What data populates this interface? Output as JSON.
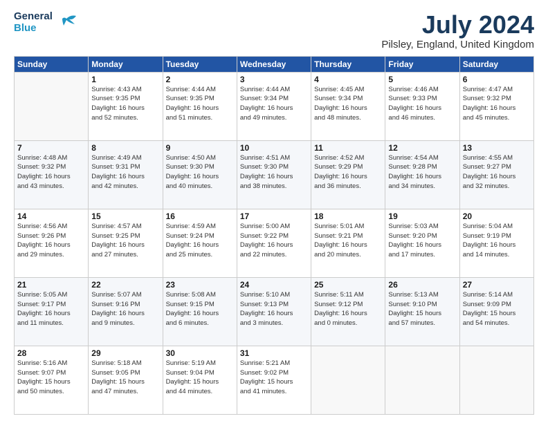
{
  "logo": {
    "general": "General",
    "blue": "Blue",
    "tagline": ""
  },
  "header": {
    "month": "July 2024",
    "location": "Pilsley, England, United Kingdom"
  },
  "weekdays": [
    "Sunday",
    "Monday",
    "Tuesday",
    "Wednesday",
    "Thursday",
    "Friday",
    "Saturday"
  ],
  "weeks": [
    [
      {
        "day": "",
        "info": ""
      },
      {
        "day": "1",
        "info": "Sunrise: 4:43 AM\nSunset: 9:35 PM\nDaylight: 16 hours\nand 52 minutes."
      },
      {
        "day": "2",
        "info": "Sunrise: 4:44 AM\nSunset: 9:35 PM\nDaylight: 16 hours\nand 51 minutes."
      },
      {
        "day": "3",
        "info": "Sunrise: 4:44 AM\nSunset: 9:34 PM\nDaylight: 16 hours\nand 49 minutes."
      },
      {
        "day": "4",
        "info": "Sunrise: 4:45 AM\nSunset: 9:34 PM\nDaylight: 16 hours\nand 48 minutes."
      },
      {
        "day": "5",
        "info": "Sunrise: 4:46 AM\nSunset: 9:33 PM\nDaylight: 16 hours\nand 46 minutes."
      },
      {
        "day": "6",
        "info": "Sunrise: 4:47 AM\nSunset: 9:32 PM\nDaylight: 16 hours\nand 45 minutes."
      }
    ],
    [
      {
        "day": "7",
        "info": "Sunrise: 4:48 AM\nSunset: 9:32 PM\nDaylight: 16 hours\nand 43 minutes."
      },
      {
        "day": "8",
        "info": "Sunrise: 4:49 AM\nSunset: 9:31 PM\nDaylight: 16 hours\nand 42 minutes."
      },
      {
        "day": "9",
        "info": "Sunrise: 4:50 AM\nSunset: 9:30 PM\nDaylight: 16 hours\nand 40 minutes."
      },
      {
        "day": "10",
        "info": "Sunrise: 4:51 AM\nSunset: 9:30 PM\nDaylight: 16 hours\nand 38 minutes."
      },
      {
        "day": "11",
        "info": "Sunrise: 4:52 AM\nSunset: 9:29 PM\nDaylight: 16 hours\nand 36 minutes."
      },
      {
        "day": "12",
        "info": "Sunrise: 4:54 AM\nSunset: 9:28 PM\nDaylight: 16 hours\nand 34 minutes."
      },
      {
        "day": "13",
        "info": "Sunrise: 4:55 AM\nSunset: 9:27 PM\nDaylight: 16 hours\nand 32 minutes."
      }
    ],
    [
      {
        "day": "14",
        "info": "Sunrise: 4:56 AM\nSunset: 9:26 PM\nDaylight: 16 hours\nand 29 minutes."
      },
      {
        "day": "15",
        "info": "Sunrise: 4:57 AM\nSunset: 9:25 PM\nDaylight: 16 hours\nand 27 minutes."
      },
      {
        "day": "16",
        "info": "Sunrise: 4:59 AM\nSunset: 9:24 PM\nDaylight: 16 hours\nand 25 minutes."
      },
      {
        "day": "17",
        "info": "Sunrise: 5:00 AM\nSunset: 9:22 PM\nDaylight: 16 hours\nand 22 minutes."
      },
      {
        "day": "18",
        "info": "Sunrise: 5:01 AM\nSunset: 9:21 PM\nDaylight: 16 hours\nand 20 minutes."
      },
      {
        "day": "19",
        "info": "Sunrise: 5:03 AM\nSunset: 9:20 PM\nDaylight: 16 hours\nand 17 minutes."
      },
      {
        "day": "20",
        "info": "Sunrise: 5:04 AM\nSunset: 9:19 PM\nDaylight: 16 hours\nand 14 minutes."
      }
    ],
    [
      {
        "day": "21",
        "info": "Sunrise: 5:05 AM\nSunset: 9:17 PM\nDaylight: 16 hours\nand 11 minutes."
      },
      {
        "day": "22",
        "info": "Sunrise: 5:07 AM\nSunset: 9:16 PM\nDaylight: 16 hours\nand 9 minutes."
      },
      {
        "day": "23",
        "info": "Sunrise: 5:08 AM\nSunset: 9:15 PM\nDaylight: 16 hours\nand 6 minutes."
      },
      {
        "day": "24",
        "info": "Sunrise: 5:10 AM\nSunset: 9:13 PM\nDaylight: 16 hours\nand 3 minutes."
      },
      {
        "day": "25",
        "info": "Sunrise: 5:11 AM\nSunset: 9:12 PM\nDaylight: 16 hours\nand 0 minutes."
      },
      {
        "day": "26",
        "info": "Sunrise: 5:13 AM\nSunset: 9:10 PM\nDaylight: 15 hours\nand 57 minutes."
      },
      {
        "day": "27",
        "info": "Sunrise: 5:14 AM\nSunset: 9:09 PM\nDaylight: 15 hours\nand 54 minutes."
      }
    ],
    [
      {
        "day": "28",
        "info": "Sunrise: 5:16 AM\nSunset: 9:07 PM\nDaylight: 15 hours\nand 50 minutes."
      },
      {
        "day": "29",
        "info": "Sunrise: 5:18 AM\nSunset: 9:05 PM\nDaylight: 15 hours\nand 47 minutes."
      },
      {
        "day": "30",
        "info": "Sunrise: 5:19 AM\nSunset: 9:04 PM\nDaylight: 15 hours\nand 44 minutes."
      },
      {
        "day": "31",
        "info": "Sunrise: 5:21 AM\nSunset: 9:02 PM\nDaylight: 15 hours\nand 41 minutes."
      },
      {
        "day": "",
        "info": ""
      },
      {
        "day": "",
        "info": ""
      },
      {
        "day": "",
        "info": ""
      }
    ]
  ]
}
